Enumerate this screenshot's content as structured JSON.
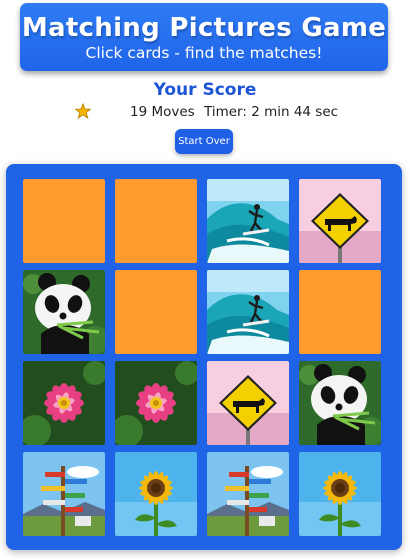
{
  "header": {
    "title": "Matching Pictures Game",
    "subtitle": "Click cards - find the matches!"
  },
  "score": {
    "title": "Your Score",
    "moves": "19 Moves",
    "timer": "Timer: 2 min 44 sec"
  },
  "controls": {
    "start_over": "Start Over"
  },
  "colors": {
    "header_blue": "#2f7cf5",
    "board_blue": "#1f63e6",
    "hidden_card_orange": "#fe9a2e",
    "score_title_blue": "#1c54d6"
  },
  "board": {
    "rows": 4,
    "cols": 4,
    "cards": [
      {
        "state": "hidden"
      },
      {
        "state": "hidden"
      },
      {
        "state": "revealed",
        "image": "surfer-wave-icon"
      },
      {
        "state": "revealed",
        "image": "cow-sign-icon"
      },
      {
        "state": "revealed",
        "image": "panda-icon"
      },
      {
        "state": "hidden"
      },
      {
        "state": "revealed",
        "image": "surfer-wave-icon"
      },
      {
        "state": "hidden"
      },
      {
        "state": "revealed",
        "image": "pink-flower-icon"
      },
      {
        "state": "revealed",
        "image": "pink-flower-icon"
      },
      {
        "state": "revealed",
        "image": "cow-sign-icon"
      },
      {
        "state": "revealed",
        "image": "panda-icon"
      },
      {
        "state": "revealed",
        "image": "signpost-icon"
      },
      {
        "state": "revealed",
        "image": "sunflower-icon"
      },
      {
        "state": "revealed",
        "image": "signpost-icon"
      },
      {
        "state": "revealed",
        "image": "sunflower-icon"
      }
    ]
  },
  "icons": {
    "score_icon": "star-icon"
  }
}
